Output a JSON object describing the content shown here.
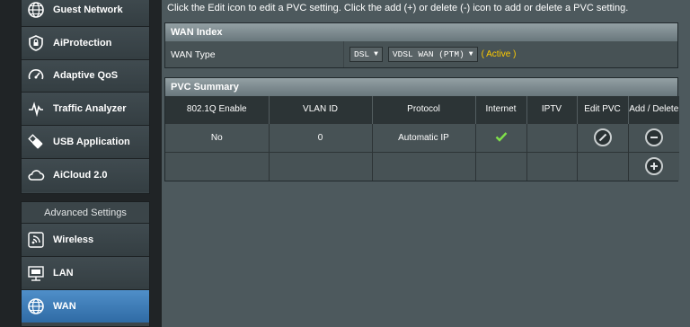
{
  "sidebar": {
    "items": [
      {
        "label": "Guest Network",
        "icon": "globe-icon"
      },
      {
        "label": "AiProtection",
        "icon": "shield-lock-icon"
      },
      {
        "label": "Adaptive QoS",
        "icon": "gauge-icon"
      },
      {
        "label": "Traffic Analyzer",
        "icon": "pulse-icon"
      },
      {
        "label": "USB Application",
        "icon": "usb-icon"
      },
      {
        "label": "AiCloud 2.0",
        "icon": "cloud-icon"
      }
    ],
    "advanced_header": "Advanced Settings",
    "advanced_items": [
      {
        "label": "Wireless",
        "icon": "wireless-icon"
      },
      {
        "label": "LAN",
        "icon": "lan-icon"
      },
      {
        "label": "WAN",
        "icon": "globe-icon"
      }
    ]
  },
  "main": {
    "instruction": "Click the Edit icon to edit a PVC setting. Click the add (+) or delete (-) icon to add or delete a PVC setting.",
    "wan_index": {
      "title": "WAN Index",
      "wan_type_label": "WAN Type",
      "wan_type_value": "DSL",
      "dsl_mode_value": "VDSL WAN (PTM)",
      "status": "( Active )"
    },
    "pvc_summary": {
      "title": "PVC Summary",
      "columns": [
        "802.1Q Enable",
        "VLAN ID",
        "Protocol",
        "Internet",
        "IPTV",
        "Edit PVC",
        "Add / Delete"
      ],
      "rows": [
        {
          "enable": "No",
          "vlan_id": "0",
          "protocol": "Automatic IP",
          "internet": "check-icon",
          "iptv": ""
        }
      ]
    }
  },
  "colors": {
    "accent_active": "#ffcc00",
    "nav_active": "#3a7bbf",
    "panel_bg": "#4d595d",
    "header_bar": "#7f8c91"
  }
}
